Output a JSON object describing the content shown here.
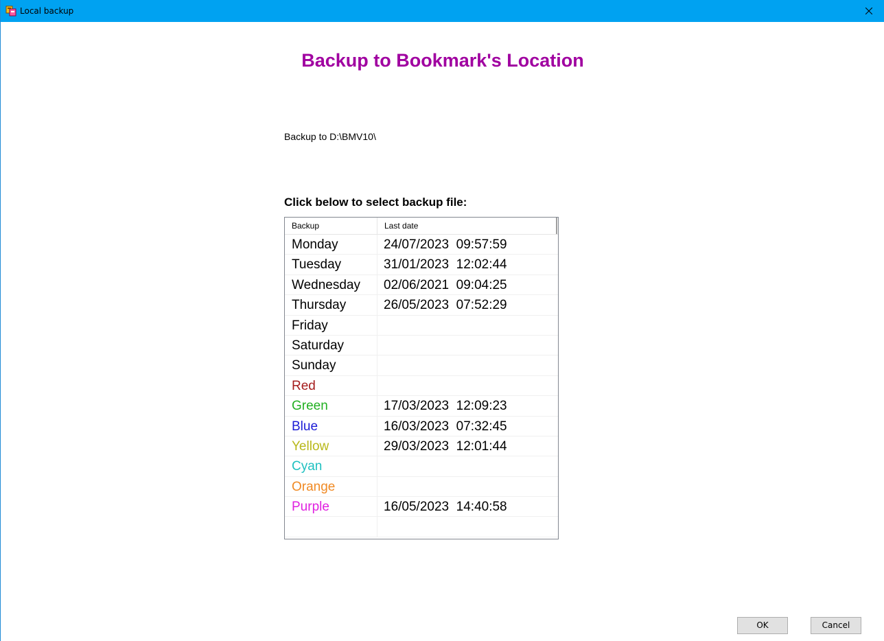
{
  "window": {
    "title": "Local backup",
    "titlebar_color": "#00a2f1"
  },
  "heading": "Backup to Bookmark's Location",
  "backup_path_text": "Backup to D:\\BMV10\\",
  "select_label": "Click below to select backup file:",
  "list": {
    "columns": [
      "Backup",
      "Last date"
    ],
    "rows": [
      {
        "name": "Monday",
        "date": "24/07/2023  09:57:59",
        "color": "#000000"
      },
      {
        "name": "Tuesday",
        "date": "31/01/2023  12:02:44",
        "color": "#000000"
      },
      {
        "name": "Wednesday",
        "date": "02/06/2021  09:04:25",
        "color": "#000000"
      },
      {
        "name": "Thursday",
        "date": "26/05/2023  07:52:29",
        "color": "#000000"
      },
      {
        "name": "Friday",
        "date": "",
        "color": "#000000"
      },
      {
        "name": "Saturday",
        "date": "",
        "color": "#000000"
      },
      {
        "name": "Sunday",
        "date": "",
        "color": "#000000"
      },
      {
        "name": "Red",
        "date": "",
        "color": "#a51c1c"
      },
      {
        "name": "Green",
        "date": "17/03/2023  12:09:23",
        "color": "#22b022"
      },
      {
        "name": "Blue",
        "date": "16/03/2023  07:32:45",
        "color": "#1c1cd6"
      },
      {
        "name": "Yellow",
        "date": "29/03/2023  12:01:44",
        "color": "#b8b81a"
      },
      {
        "name": "Cyan",
        "date": "",
        "color": "#1fc0c0"
      },
      {
        "name": "Orange",
        "date": "",
        "color": "#f08a24"
      },
      {
        "name": "Purple",
        "date": "16/05/2023  14:40:58",
        "color": "#e020e0"
      },
      {
        "name": "",
        "date": "",
        "color": "#000000"
      }
    ]
  },
  "buttons": {
    "ok_label": "OK",
    "cancel_label": "Cancel"
  },
  "icons": {
    "app": "backup-app-icon",
    "close": "close-icon"
  }
}
